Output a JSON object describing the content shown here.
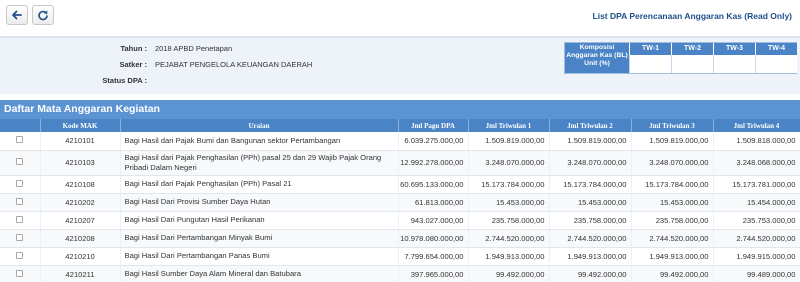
{
  "toolbar": {
    "back_icon": "arrow-left-icon",
    "refresh_icon": "refresh-icon"
  },
  "page_title": "List DPA Perencanaan Anggaran Kas (Read Only)",
  "info": {
    "tahun_label": "Tahun :",
    "tahun_value": "2018 APBD Penetapan",
    "satker_label": "Satker :",
    "satker_value": "PEJABAT PENGELOLA KEUANGAN DAERAH",
    "status_label": "Status DPA :",
    "status_value": ""
  },
  "komposisi": {
    "header": "Komposisi Anggaran Kas (BL) Unit (%)",
    "columns": [
      "TW-1",
      "TW-2",
      "TW-3",
      "TW-4"
    ]
  },
  "section_title": "Daftar Mata Anggaran Kegiatan",
  "table": {
    "headers": [
      "",
      "Kode MAK",
      "Uraian",
      "Jml Pagu DPA",
      "Jml Triwulan 1",
      "Jml Triwulan 2",
      "Jml Triwulan 3",
      "Jml Triwulan 4"
    ],
    "rows": [
      {
        "kode": "4210101",
        "uraian": "Bagi Hasil dari Pajak Bumi dan Bangunan sektor Pertambangan",
        "pagu": "6.039.275.000,00",
        "tw1": "1.509.819.000,00",
        "tw2": "1.509.819.000,00",
        "tw3": "1.509.819.000,00",
        "tw4": "1.509.818.000,00"
      },
      {
        "kode": "4210103",
        "uraian": "Bagi Hasil dari Pajak Penghasilan (PPh) pasal 25 dan 29 Wajib Pajak Orang Pribadi Dalam Negeri",
        "pagu": "12.992.278.000,00",
        "tw1": "3.248.070.000,00",
        "tw2": "3.248.070.000,00",
        "tw3": "3.248.070.000,00",
        "tw4": "3.248.068.000,00"
      },
      {
        "kode": "4210108",
        "uraian": "Bagi Hasil dari Pajak Penghasilan (PPh) Pasal 21",
        "pagu": "60.695.133.000,00",
        "tw1": "15.173.784.000,00",
        "tw2": "15.173.784.000,00",
        "tw3": "15.173.784.000,00",
        "tw4": "15.173.781.000,00"
      },
      {
        "kode": "4210202",
        "uraian": "Bagi Hasil Dari Provisi Sumber Daya Hutan",
        "pagu": "61.813.000,00",
        "tw1": "15.453.000,00",
        "tw2": "15.453.000,00",
        "tw3": "15.453.000,00",
        "tw4": "15.454.000,00"
      },
      {
        "kode": "4210207",
        "uraian": "Bagi Hasil Dari Pungutan Hasil Perikanan",
        "pagu": "943.027.000,00",
        "tw1": "235.758.000,00",
        "tw2": "235.758.000,00",
        "tw3": "235.758.000,00",
        "tw4": "235.753.000,00"
      },
      {
        "kode": "4210208",
        "uraian": "Bagi Hasil Dari Pertambangan Minyak Bumi",
        "pagu": "10.978.080.000,00",
        "tw1": "2.744.520.000,00",
        "tw2": "2.744.520.000,00",
        "tw3": "2.744.520.000,00",
        "tw4": "2.744.520.000,00"
      },
      {
        "kode": "4210210",
        "uraian": "Bagi Hasil Dari Pertambangan Panas Bumi",
        "pagu": "7.799.654.000,00",
        "tw1": "1.949.913.000,00",
        "tw2": "1.949.913.000,00",
        "tw3": "1.949.913.000,00",
        "tw4": "1.949.915.000,00"
      },
      {
        "kode": "4210211",
        "uraian": "Bagi Hasil Sumber Daya Alam Mineral dan Batubara",
        "pagu": "397.965.000,00",
        "tw1": "99.492.000,00",
        "tw2": "99.492.000,00",
        "tw3": "99.492.000,00",
        "tw4": "99.489.000,00"
      }
    ]
  }
}
